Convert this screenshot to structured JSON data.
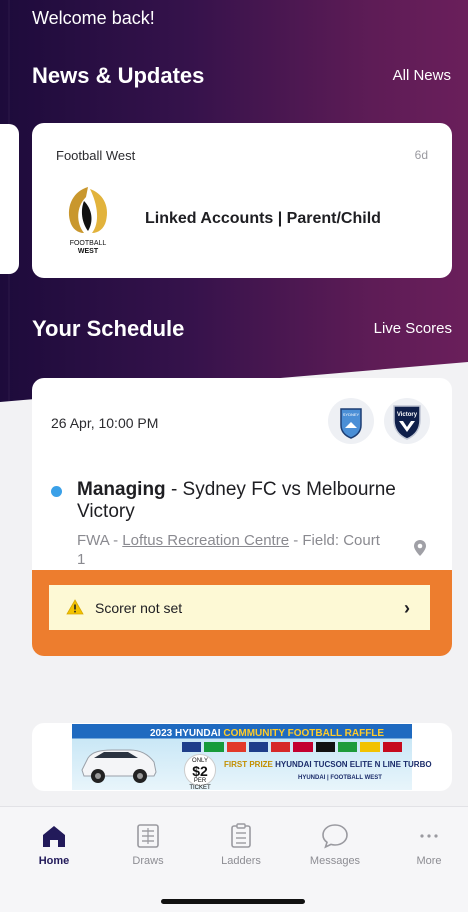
{
  "header": {
    "welcome": "Welcome back!"
  },
  "news": {
    "title": "News & Updates",
    "link_label": "All News",
    "card": {
      "source": "Football West",
      "age": "6d",
      "logo_text_top": "FOOTBALL",
      "logo_text_bottom": "WEST",
      "headline": "Linked Accounts | Parent/Child"
    }
  },
  "schedule": {
    "title": "Your Schedule",
    "link_label": "Live Scores",
    "match": {
      "datetime": "26 Apr, 10:00 PM",
      "role": "Managing",
      "fixture": " - Sydney FC vs Melbourne Victory",
      "comp": "FWA - ",
      "venue": "Loftus Recreation Centre",
      "field": " - Field: Court 1",
      "home_badge": "SYDNEY",
      "away_badge": "Victory",
      "alert": "Scorer not set"
    }
  },
  "ad": {
    "title_a": "2023 HYUNDAI ",
    "title_b": "COMMUNITY FOOTBALL RAFFLE",
    "price_top": "ONLY",
    "price": "$2",
    "price_bottom": "PER TICKET",
    "prize_a": "FIRST PRIZE ",
    "prize_b": "HYUNDAI TUCSON ELITE N LINE TURBO",
    "sponsor": "HYUNDAI | FOOTBALL WEST"
  },
  "tabs": [
    {
      "label": "Home",
      "icon": "home-icon",
      "active": true
    },
    {
      "label": "Draws",
      "icon": "draws-icon"
    },
    {
      "label": "Ladders",
      "icon": "ladders-icon"
    },
    {
      "label": "Messages",
      "icon": "messages-icon"
    },
    {
      "label": "More",
      "icon": "more-icon"
    }
  ],
  "colors": {
    "hero_start": "#1d0b3b",
    "hero_end": "#6a1f5b",
    "alert_border": "#ed7d2e",
    "alert_fill": "#fdf9d5",
    "status_dot": "#3aa0e8",
    "active_tab": "#221a5a"
  }
}
